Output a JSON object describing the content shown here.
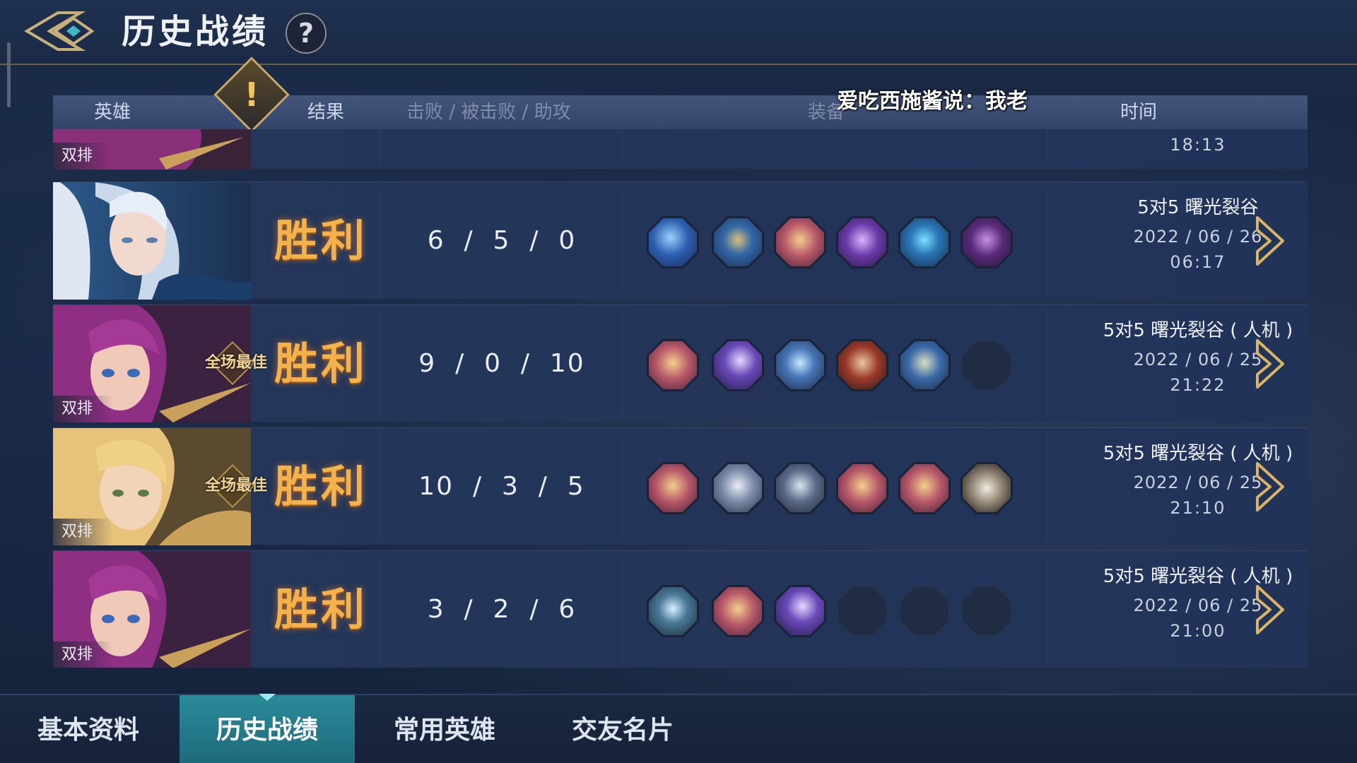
{
  "header": {
    "title": "历史战绩",
    "help_label": "?"
  },
  "columns": {
    "hero": "英雄",
    "result": "结果",
    "kda": "击败 / 被击败 / 助攻",
    "items": "装备",
    "time": "时间"
  },
  "danmaku": "爱吃西施酱说：我老",
  "partial_row": {
    "time": "18:13",
    "tag": "双排"
  },
  "matches": [
    {
      "hero_icon": "silver-haired-heroine-avatar",
      "tag": "",
      "mvp": "",
      "result": "胜利",
      "kda": "6  /  5  /  0",
      "mode": "5对5 曙光裂谷",
      "date": "2022 / 06 / 26",
      "time": "06:17",
      "items": [
        "blue-wing-item-icon",
        "blue-tome-item-icon",
        "gold-armor-item-icon",
        "purple-crystal-item-icon",
        "blue-ring-item-icon",
        "purple-helm-item-icon"
      ]
    },
    {
      "hero_icon": "pink-haired-heroine-avatar",
      "tag": "双排",
      "mvp": "全场最佳",
      "result": "胜利",
      "kda": "9  /  0  /  10",
      "mode": "5对5 曙光裂谷 ( 人机 )",
      "date": "2022 / 06 / 25",
      "time": "21:22",
      "items": [
        "gold-armor-item-icon",
        "purple-scythe-item-icon",
        "blue-claw-item-icon",
        "red-quiver-item-icon",
        "blue-quiver-item-icon",
        "empty-slot"
      ]
    },
    {
      "hero_icon": "blonde-heroine-avatar",
      "tag": "双排",
      "mvp": "全场最佳",
      "result": "胜利",
      "kda": "10  /  3  /  5",
      "mode": "5对5 曙光裂谷 ( 人机 )",
      "date": "2022 / 06 / 25",
      "time": "21:10",
      "items": [
        "gold-armor-item-icon",
        "silver-ring-item-icon",
        "steel-ring-item-icon",
        "gold-armor-item-icon",
        "gold-armor-item-icon",
        "silver-shield-item-icon"
      ]
    },
    {
      "hero_icon": "pink-haired-heroine-avatar",
      "tag": "双排",
      "mvp": "",
      "result": "胜利",
      "kda": "3  /  2  /  6",
      "mode": "5对5 曙光裂谷 ( 人机 )",
      "date": "2022 / 06 / 25",
      "time": "21:00",
      "items": [
        "lightning-blade-item-icon",
        "gold-armor-item-icon",
        "purple-scythe-item-icon",
        "empty-slot",
        "empty-slot",
        "empty-slot"
      ]
    }
  ],
  "tabs": [
    {
      "label": "基本资料",
      "active": false
    },
    {
      "label": "历史战绩",
      "active": true
    },
    {
      "label": "常用英雄",
      "active": false
    },
    {
      "label": "交友名片",
      "active": false
    }
  ],
  "colors": {
    "victory": "#f4b24a",
    "active_tab": "#2a8b98",
    "accent_gold": "#c8a767"
  }
}
